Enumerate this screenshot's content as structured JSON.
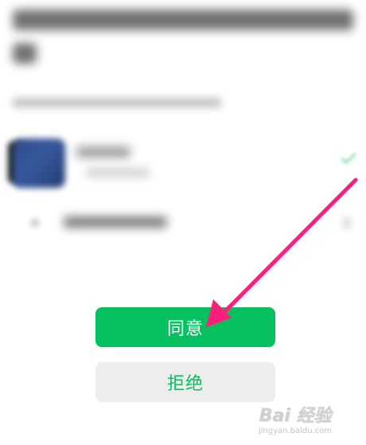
{
  "buttons": {
    "agree_label": "同意",
    "reject_label": "拒绝"
  },
  "colors": {
    "primary_green": "#07c160",
    "secondary_bg": "#ededed",
    "annotation_arrow": "#ff1f7a"
  },
  "annotation": {
    "type": "arrow",
    "icon": "arrow-pointer-icon"
  },
  "watermark": {
    "main": "Bai 经验",
    "sub": "jingyan.baidu.com"
  }
}
